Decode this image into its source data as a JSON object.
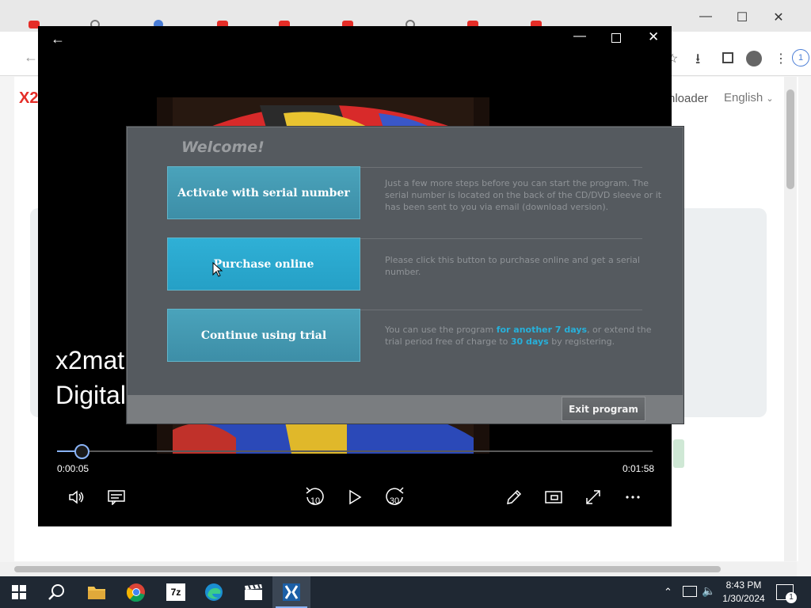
{
  "browser": {
    "page_logo": "X2",
    "nav_text": "nloader",
    "language": "English",
    "colors": {
      "logo": "#e52d27",
      "accent": "#8ab4f8"
    }
  },
  "player": {
    "title_line1": "x2mat",
    "title_line2": "Digital",
    "current_time": "0:00:05",
    "total_time": "0:01:58",
    "progress_fraction": 0.042,
    "icons": [
      "back-arrow-icon",
      "minimize-icon",
      "maximize-icon",
      "close-icon",
      "volume-icon",
      "subtitles-icon",
      "rewind-10-icon",
      "play-icon",
      "forward-30-icon",
      "edit-icon",
      "miniplayer-icon",
      "fullscreen-icon",
      "more-icon"
    ],
    "rewind_label": "10",
    "forward_label": "30"
  },
  "dialog": {
    "title": "Welcome!",
    "activate_label": "Activate with serial number",
    "activate_desc": "Just a few more steps before you can start the program. The serial number is located on the back of the CD/DVD sleeve or it has been sent to you via email (download version).",
    "purchase_label": "Purchase online",
    "purchase_desc": "Please click this button to purchase online and get a serial number.",
    "trial_label": "Continue using trial",
    "trial_desc_1": "You can use the program ",
    "trial_desc_hl1": "for another 7 days",
    "trial_desc_2": ", or extend the trial period free of charge to ",
    "trial_desc_hl2": "30 days",
    "trial_desc_3": " by registering.",
    "exit_label": "Exit program"
  },
  "taskbar": {
    "apps": [
      "start-icon",
      "search-icon",
      "file-explorer-icon",
      "chrome-icon",
      "7zip-icon",
      "edge-icon",
      "clapper-icon",
      "video-editor-icon"
    ],
    "zip_label": "7z",
    "time": "8:43 PM",
    "date": "1/30/2024",
    "notification_count": "1"
  }
}
